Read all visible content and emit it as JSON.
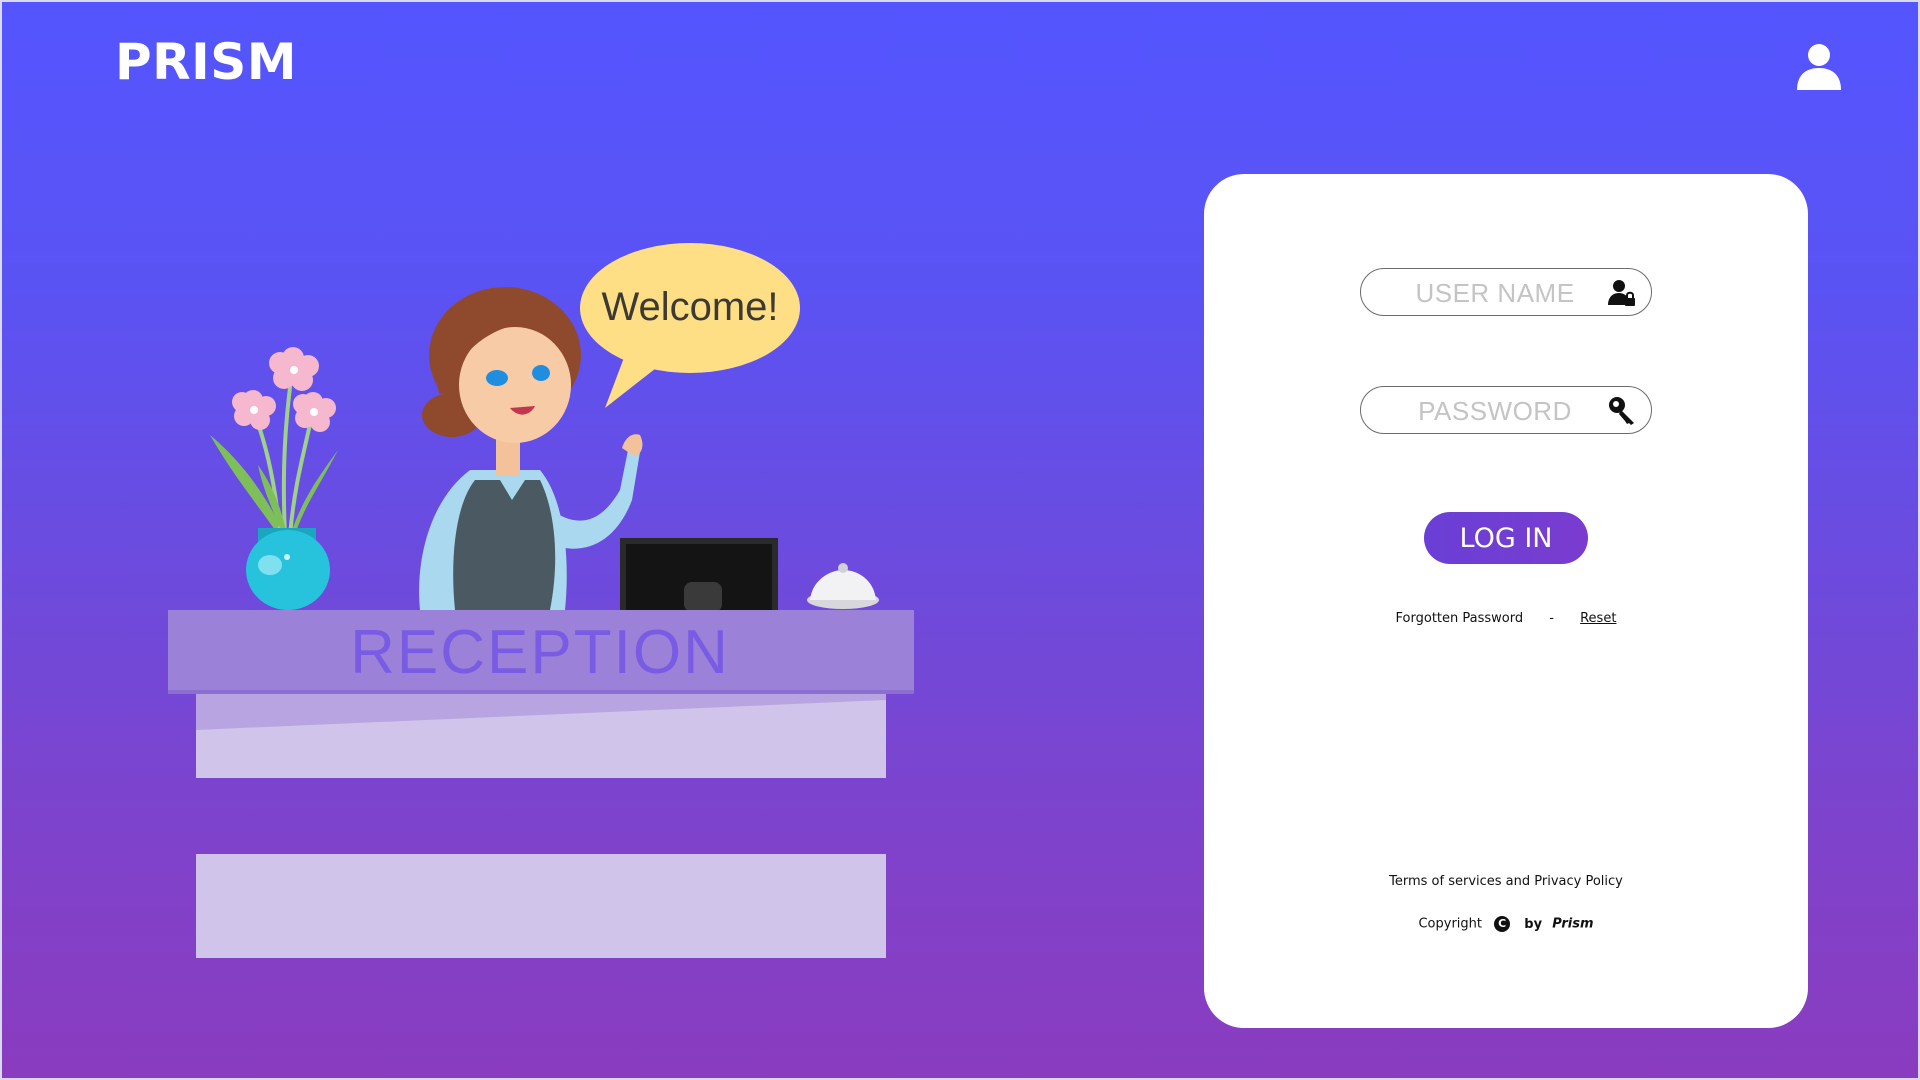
{
  "header": {
    "brand": "PRISM",
    "user_icon": "user-icon"
  },
  "illustration": {
    "speech_bubble": "Welcome!",
    "desk_sign": "RECEPTION"
  },
  "login_form": {
    "username_placeholder": "USER NAME",
    "username_icon": "user-lock-icon",
    "password_placeholder": "PASSWORD",
    "password_icon": "key-icon",
    "login_label": "LOG IN",
    "forgot_label": "Forgotten Password",
    "separator": "-",
    "reset_label": "Reset"
  },
  "footer": {
    "terms": "Terms of services and Privacy Policy",
    "copyright_label": "Copyright",
    "copyright_symbol": "C",
    "by_label": "by",
    "company": "Prism"
  },
  "colors": {
    "gradient_top": "#5455fe",
    "gradient_bottom": "#8a3cbf",
    "button": "#6a3fd6",
    "card": "#ffffff"
  }
}
